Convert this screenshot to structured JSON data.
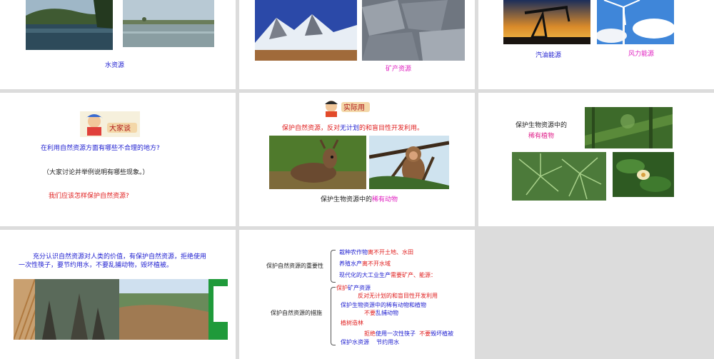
{
  "slides": {
    "s1": {
      "caption": "水资源"
    },
    "s2": {
      "caption": "矿产资源"
    },
    "s3": {
      "caption_left": "汽油能源",
      "caption_right": "风力能源"
    },
    "s4": {
      "badge": "大家谈",
      "question": "在利用自然资源方面有哪些不合理的地方?",
      "hint": "（大家讨论并举例说明有哪些现象。）",
      "question2": "我们应该怎样保护自然资源?"
    },
    "s5": {
      "badge": "实际用",
      "headline_a": "保护自然资源，反对",
      "headline_b": "无计划",
      "headline_c": "的和盲目性开发利用。",
      "caption_a": "保护生物资源中的",
      "caption_b": "稀有动物"
    },
    "s6": {
      "line1": "保护生物资源中的",
      "line2": "稀有植物"
    },
    "s7": {
      "para_line1": "充分认识自然资源对人类的价值，有保护自然资源，拒绝使用",
      "para_line2": "一次性筷子，要节约用水，不要乱捕动物，毁坏植被。"
    },
    "s8": {
      "label_importance": "保护自然资源的重要性",
      "imp1_a": "栽种农作物",
      "imp1_b": "离不开土地、水田",
      "imp2_a": "养殖水产",
      "imp2_b": "离不开水域",
      "imp3_a": "现代化的大工业生产",
      "imp3_b": "需要矿产、能源：",
      "label_measures": "保护自然资源的措施",
      "m1_a": "保护",
      "m1_b": "矿产资源",
      "m2": "反对无计划的和盲目性开发利用",
      "m3": "保护生物资源中的稀有动物和植物",
      "m4_a": "不要",
      "m4_b": "乱捕动物",
      "m5": "植树造林",
      "m6_a": "拒绝",
      "m6_b": "使用一次性筷子",
      "m6_c": "不要",
      "m6_d": "毁坏植被",
      "m7_a": "保护水资源",
      "m7_b": "节约用水"
    }
  },
  "colors": {
    "blue": "#1f1fd0",
    "red": "#e02020",
    "pink": "#e020c0",
    "background": "#dcdcdc"
  }
}
